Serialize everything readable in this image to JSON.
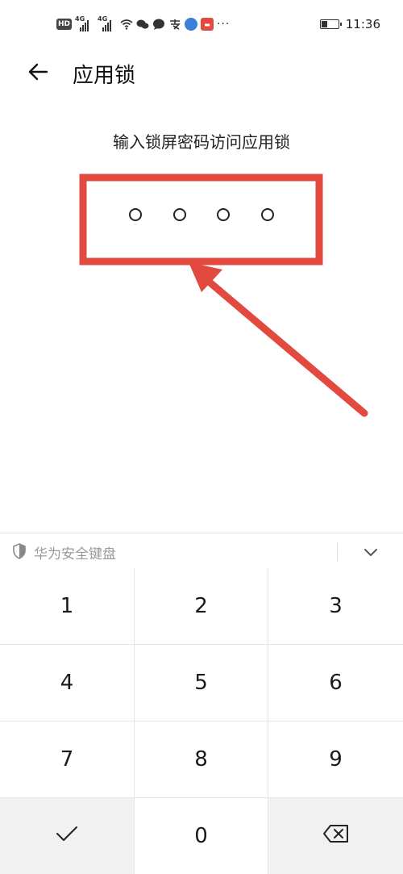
{
  "status_bar": {
    "hd_badge": "HD",
    "network1": "4G",
    "network2": "4G",
    "icons": [
      "wifi-icon",
      "wechat-icon",
      "message-bubble-icon",
      "alipay-icon",
      "globe-icon",
      "app-notification-icon"
    ],
    "overflow": "···",
    "time": "11:36"
  },
  "header": {
    "title": "应用锁"
  },
  "prompt": "输入锁屏密码访问应用锁",
  "pin": {
    "length": 4,
    "entered": 0
  },
  "annotation": {
    "color": "#e24a3f"
  },
  "keyboard": {
    "label": "华为安全键盘",
    "keys": [
      "1",
      "2",
      "3",
      "4",
      "5",
      "6",
      "7",
      "8",
      "9",
      "0"
    ],
    "confirm_icon": "checkmark-icon",
    "delete_icon": "backspace-icon"
  }
}
